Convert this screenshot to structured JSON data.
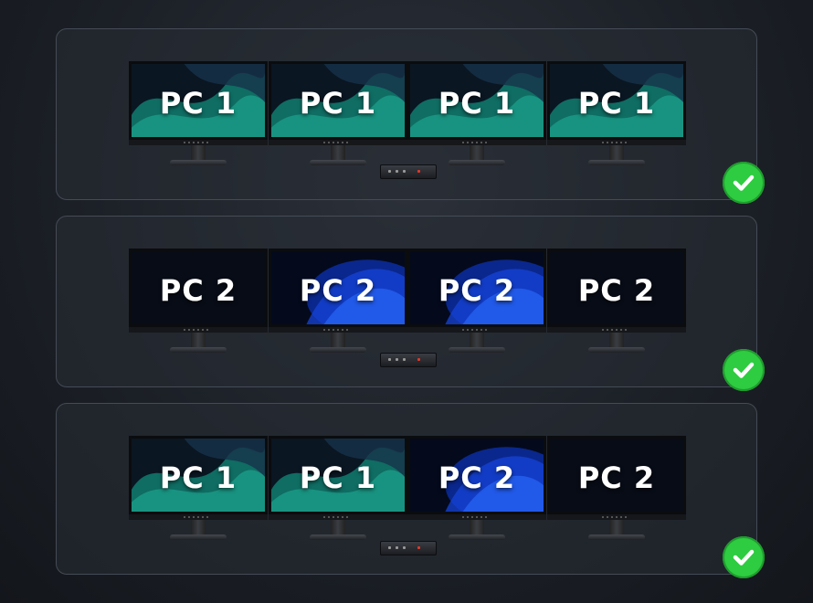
{
  "colors": {
    "check": "#2ecc40",
    "panel_border": "#454b55"
  },
  "panels": [
    {
      "screens": [
        {
          "label": "PC 1",
          "wallpaper": "green-waves"
        },
        {
          "label": "PC 1",
          "wallpaper": "green-waves"
        },
        {
          "label": "PC 1",
          "wallpaper": "green-waves"
        },
        {
          "label": "PC 1",
          "wallpaper": "green-waves"
        }
      ]
    },
    {
      "screens": [
        {
          "label": "PC 2",
          "wallpaper": "dark"
        },
        {
          "label": "PC 2",
          "wallpaper": "blue-bloom"
        },
        {
          "label": "PC 2",
          "wallpaper": "blue-bloom"
        },
        {
          "label": "PC 2",
          "wallpaper": "dark"
        }
      ]
    },
    {
      "screens": [
        {
          "label": "PC 1",
          "wallpaper": "green-waves"
        },
        {
          "label": "PC 1",
          "wallpaper": "green-waves"
        },
        {
          "label": "PC 2",
          "wallpaper": "blue-bloom"
        },
        {
          "label": "PC 2",
          "wallpaper": "dark"
        }
      ]
    }
  ],
  "icons": {
    "status": "checkmark-icon"
  }
}
